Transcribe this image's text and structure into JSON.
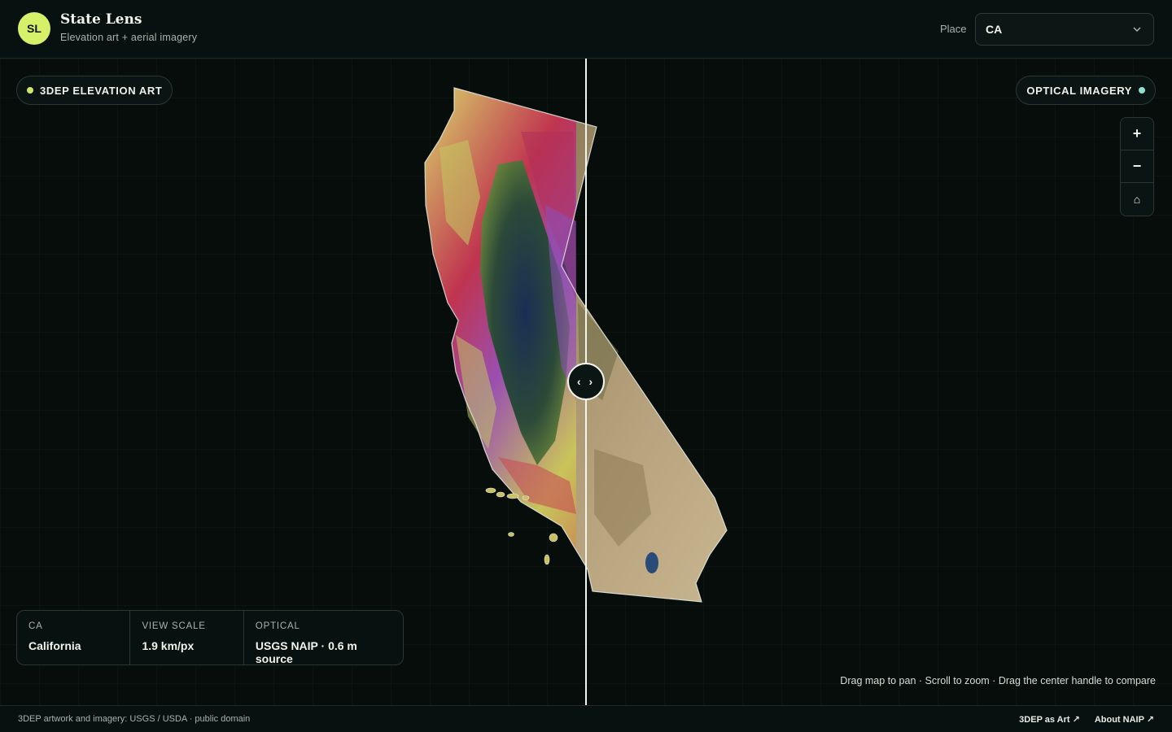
{
  "app": {
    "logo_text": "SL",
    "title": "State Lens",
    "subtitle": "Elevation art + aerial imagery"
  },
  "place": {
    "label": "Place",
    "value": "CA"
  },
  "layers": {
    "left_label": "3DEP ELEVATION ART",
    "left_dot_color": "#cfe86a",
    "right_label": "OPTICAL IMAGERY",
    "right_dot_color": "#8fe0d0"
  },
  "zoom": {
    "in": "+",
    "out": "−",
    "home": "⌂"
  },
  "compare_handle": {
    "glyph": "‹ ›"
  },
  "info": [
    {
      "key": "CA",
      "value": "California"
    },
    {
      "key": "VIEW SCALE",
      "value": "1.9 km/px"
    },
    {
      "key": "OPTICAL",
      "value": "USGS NAIP · 0.6 m source"
    }
  ],
  "hint": "Drag map to pan · Scroll to zoom · Drag the center handle to compare",
  "footer": {
    "credit": "3DEP artwork and imagery: USGS / USDA · public domain",
    "links": [
      "3DEP as Art ↗",
      "About NAIP ↗"
    ]
  }
}
